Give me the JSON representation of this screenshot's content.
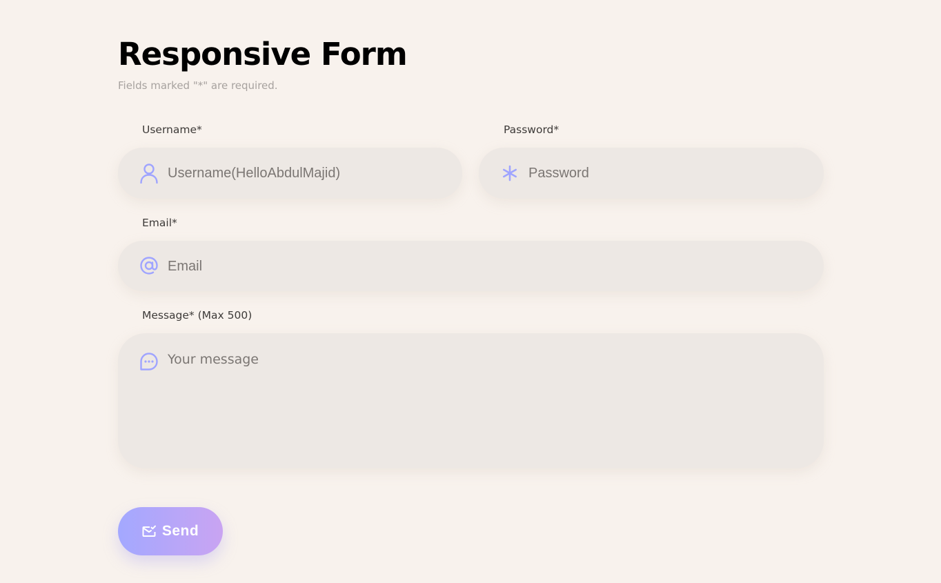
{
  "form": {
    "title": "Responsive Form",
    "subtitle": "Fields marked \"*\" are required.",
    "username": {
      "label": "Username*",
      "placeholder": "Username(HelloAbdulMajid)",
      "value": "",
      "icon": "user-icon"
    },
    "password": {
      "label": "Password*",
      "placeholder": "Password",
      "value": "",
      "icon": "asterisk-icon"
    },
    "email": {
      "label": "Email*",
      "placeholder": "Email",
      "value": "",
      "icon": "at-sign-icon"
    },
    "message": {
      "label": "Message* (Max 500)",
      "placeholder": "Your message",
      "value": "",
      "icon": "chat-bubble-icon"
    },
    "send_label": "Send",
    "send_icon": "mail-check-icon"
  },
  "colors": {
    "background": "#f8f2ed",
    "field_background": "#ede8e4",
    "icon_accent": "#9fa4ff",
    "button_gradient_start": "#a3a8ff",
    "button_gradient_end": "#c9a4f2"
  }
}
